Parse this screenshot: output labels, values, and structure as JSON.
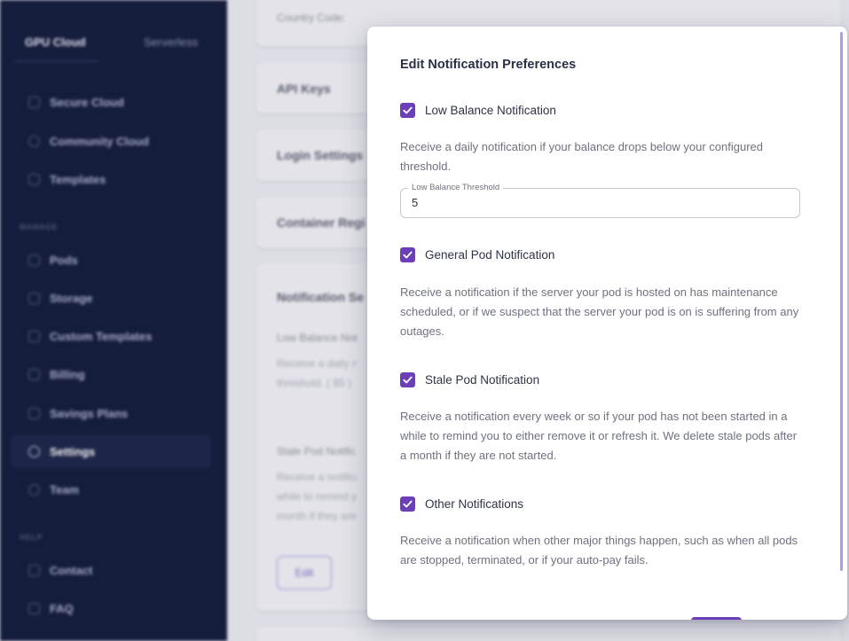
{
  "sidebar": {
    "tabs": [
      {
        "label": "GPU Cloud"
      },
      {
        "label": "Serverless"
      }
    ],
    "items_top": [
      {
        "label": "Secure Cloud"
      },
      {
        "label": "Community Cloud"
      },
      {
        "label": "Templates"
      }
    ],
    "section_manage": "MANAGE",
    "items_manage": [
      {
        "label": "Pods"
      },
      {
        "label": "Storage"
      },
      {
        "label": "Custom Templates"
      },
      {
        "label": "Billing"
      },
      {
        "label": "Savings Plans"
      },
      {
        "label": "Settings"
      },
      {
        "label": "Team"
      }
    ],
    "section_help": "HELP",
    "items_help": [
      {
        "label": "Contact"
      },
      {
        "label": "FAQ"
      }
    ]
  },
  "background": {
    "country_code_label": "Country Code:",
    "cards": [
      {
        "title": "API Keys"
      },
      {
        "title": "Login Settings"
      },
      {
        "title": "Container Regi"
      }
    ],
    "notification_card": {
      "title": "Notification Se",
      "low_balance_label": "Low Balance Not",
      "low_balance_text_1": "Receive a daily n",
      "low_balance_text_2": "threshold. ( $5 )",
      "stale_label": "Stale Pod Notific",
      "stale_text_1": "Receive a notifica",
      "stale_text_2": "while to remind y",
      "stale_text_3": "month if they are",
      "edit_label": "Edit"
    }
  },
  "modal": {
    "title": "Edit Notification Preferences",
    "accent_color": "#6c3fb8",
    "low_balance": {
      "checked": true,
      "label": "Low Balance Notification",
      "description": "Receive a daily notification if your balance drops below your configured threshold.",
      "threshold_label": "Low Balance Threshold",
      "threshold_value": "5"
    },
    "general_pod": {
      "checked": true,
      "label": "General Pod Notification",
      "description": "Receive a notification if the server your pod is hosted on has maintenance scheduled, or if we suspect that the server your pod is on is suffering from any outages."
    },
    "stale_pod": {
      "checked": true,
      "label": "Stale Pod Notification",
      "description": "Receive a notification every week or so if your pod has not been started in a while to remind you to either remove it or refresh it. We delete stale pods after a month if they are not started."
    },
    "other": {
      "checked": true,
      "label": "Other Notifications",
      "description": "Receive a notification when other major things happen, such as when all pods are stopped, terminated, or if your auto-pay fails."
    }
  }
}
